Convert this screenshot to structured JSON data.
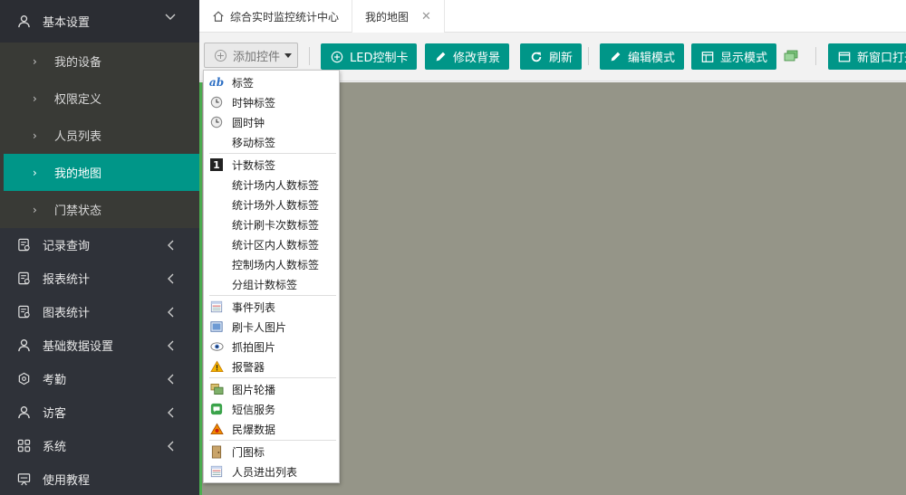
{
  "sidebar": {
    "group_basic": {
      "label": "基本设置",
      "icon": "user-icon"
    },
    "sub_items": [
      {
        "label": "我的设备"
      },
      {
        "label": "权限定义"
      },
      {
        "label": "人员列表"
      },
      {
        "label": "我的地图"
      },
      {
        "label": "门禁状态"
      }
    ],
    "groups": [
      {
        "label": "记录查询",
        "icon": "record-icon"
      },
      {
        "label": "报表统计",
        "icon": "report-icon"
      },
      {
        "label": "图表统计",
        "icon": "chart-icon"
      },
      {
        "label": "基础数据设置",
        "icon": "user-icon"
      },
      {
        "label": "考勤",
        "icon": "attendance-icon"
      },
      {
        "label": "访客",
        "icon": "user-icon"
      },
      {
        "label": "系统",
        "icon": "grid-icon"
      },
      {
        "label": "使用教程",
        "icon": "tutorial-icon"
      }
    ]
  },
  "tabs": {
    "home_label": "综合实时监控统计中心",
    "active_label": "我的地图"
  },
  "toolbar": {
    "add_control": "添加控件",
    "led_card": "LED控制卡",
    "change_bg": "修改背景",
    "refresh": "刷新",
    "edit_mode": "编辑模式",
    "display_mode": "显示模式",
    "new_window": "新窗口打开"
  },
  "menu": {
    "groups": [
      [
        {
          "label": "标签",
          "icon": "ab-text-icon"
        },
        {
          "label": "时钟标签",
          "icon": "clock-icon"
        },
        {
          "label": "圆时钟",
          "icon": "clock-icon"
        },
        {
          "label": "移动标签",
          "icon": ""
        }
      ],
      [
        {
          "label": "计数标签",
          "icon": "counter-icon"
        },
        {
          "label": "统计场内人数标签",
          "icon": ""
        },
        {
          "label": "统计场外人数标签",
          "icon": ""
        },
        {
          "label": "统计刷卡次数标签",
          "icon": ""
        },
        {
          "label": "统计区内人数标签",
          "icon": ""
        },
        {
          "label": "控制场内人数标签",
          "icon": ""
        },
        {
          "label": "分组计数标签",
          "icon": ""
        }
      ],
      [
        {
          "label": "事件列表",
          "icon": "list-icon"
        },
        {
          "label": "刷卡人图片",
          "icon": "picture-icon"
        },
        {
          "label": "抓拍图片",
          "icon": "eye-icon"
        },
        {
          "label": "报警器",
          "icon": "warning-icon"
        }
      ],
      [
        {
          "label": "图片轮播",
          "icon": "slideshow-icon"
        },
        {
          "label": "短信服务",
          "icon": "sms-icon"
        },
        {
          "label": "民爆数据",
          "icon": "explosive-warning-icon"
        }
      ],
      [
        {
          "label": "门图标",
          "icon": "door-icon"
        },
        {
          "label": "人员进出列表",
          "icon": "list-icon"
        }
      ]
    ]
  },
  "colors": {
    "accent": "#009688",
    "sidebar_bg": "#2f3239",
    "canvas_bg": "#959588"
  }
}
